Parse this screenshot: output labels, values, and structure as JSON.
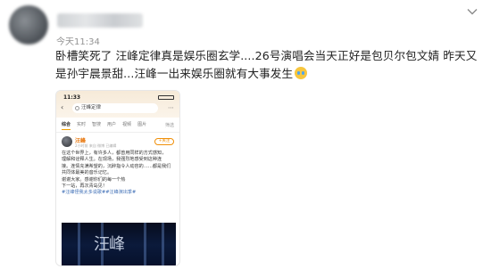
{
  "post": {
    "timestamp": "今天11:34",
    "text": "卧槽笑死了 汪峰定律真是娱乐圈玄学....26号演唱会当天正好是包贝尔包文婧 昨天又是孙宇晨景甜...汪峰一出来娱乐圈就有大事发生",
    "emoji_icon": "crying-laughing-emoji"
  },
  "screenshot": {
    "time": "11:33",
    "search_query": "汪峰定律",
    "tabs": [
      "综合",
      "实时",
      "智搜",
      "用户",
      "视频",
      "图片"
    ],
    "active_tab": "综合",
    "filter_label": "筛选",
    "user": "汪峰",
    "meta": "2小时前 来自 微博 已编辑",
    "follow_label": "+关注",
    "body_lines": [
      "在这个世界上，有许多人，都曾用同样的方式感知，",
      "理解和诠释人生。在现场，我强烈地感受到这种连",
      "接。连情充满希望的，沉醉指令人动容的……都是我们",
      "共同体最美的音乐记忆。",
      "谢谢大家。感谢你们的每一个热",
      "下一站，再次青岛见！"
    ],
    "hashtags": "#汪峰怪我太多说歌##汪峰演出季#",
    "video_title": "汪峰"
  },
  "colors": {
    "accent": "#e8760b",
    "text": "#222222",
    "muted": "#939393"
  }
}
